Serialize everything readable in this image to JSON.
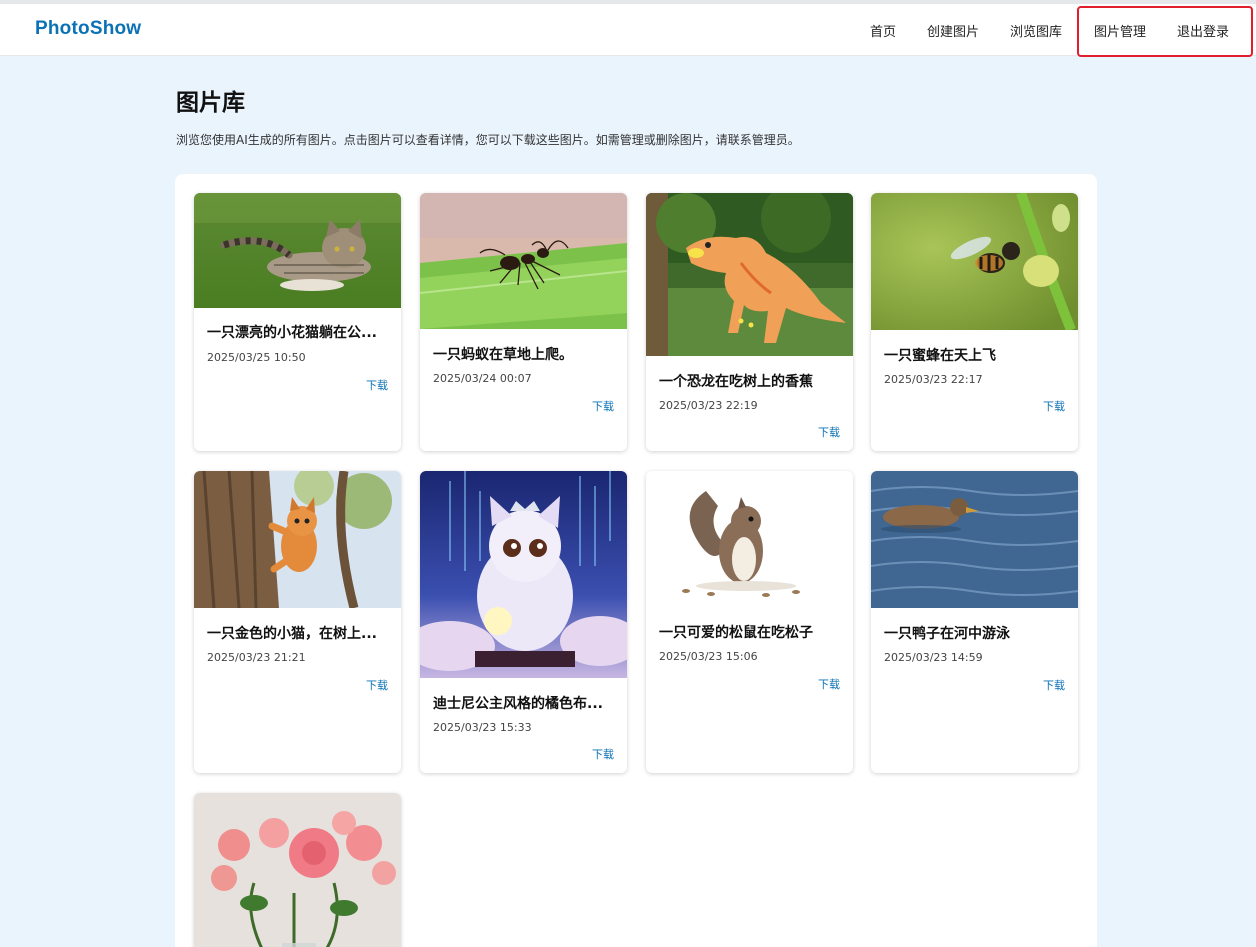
{
  "app": {
    "brand": "PhotoShow"
  },
  "nav": {
    "items": [
      {
        "label": "首页"
      },
      {
        "label": "创建图片"
      },
      {
        "label": "浏览图库"
      },
      {
        "label": "图片管理"
      },
      {
        "label": "退出登录"
      }
    ]
  },
  "page": {
    "title": "图片库",
    "description": "浏览您使用AI生成的所有图片。点击图片可以查看详情，您可以下载这些图片。如需管理或删除图片，请联系管理员。"
  },
  "gallery": {
    "download_label": "下载",
    "cards": [
      {
        "title": "一只漂亮的小花猫躺在公...",
        "date": "2025/03/25 10:50",
        "image": "tabby-cat-on-grass"
      },
      {
        "title": "一只蚂蚁在草地上爬。",
        "date": "2025/03/24 00:07",
        "image": "ant-on-leaf"
      },
      {
        "title": "一个恐龙在吃树上的香蕉",
        "date": "2025/03/23 22:19",
        "image": "cartoon-dinosaur"
      },
      {
        "title": "一只蜜蜂在天上飞",
        "date": "2025/03/23 22:17",
        "image": "bee-on-flower"
      },
      {
        "title": "一只金色的小猫，在树上...",
        "date": "2025/03/23 21:21",
        "image": "kitten-climbing-tree"
      },
      {
        "title": "迪士尼公主风格的橘色布...",
        "date": "2025/03/23 15:33",
        "image": "princess-cat-fantasy"
      },
      {
        "title": "一只可爱的松鼠在吃松子",
        "date": "2025/03/23 15:06",
        "image": "squirrel-eating"
      },
      {
        "title": "一只鸭子在河中游泳",
        "date": "2025/03/23 14:59",
        "image": "duck-swimming"
      },
      {
        "title": "",
        "date": "",
        "image": "pink-roses-vase"
      }
    ]
  }
}
